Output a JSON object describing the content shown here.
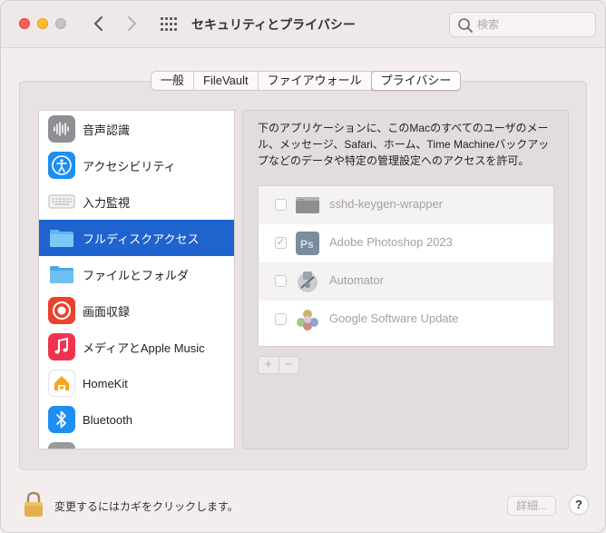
{
  "window": {
    "title": "セキュリティとプライバシー"
  },
  "search": {
    "placeholder": "検索"
  },
  "tabs": [
    {
      "label": "一般",
      "active": false
    },
    {
      "label": "FileVault",
      "active": false
    },
    {
      "label": "ファイアウォール",
      "active": false
    },
    {
      "label": "プライバシー",
      "active": true
    }
  ],
  "sidebar": {
    "selected_index": 3,
    "items": [
      {
        "label": "音声認識",
        "icon": "waveform-icon"
      },
      {
        "label": "アクセシビリティ",
        "icon": "accessibility-icon"
      },
      {
        "label": "入力監視",
        "icon": "keyboard-icon"
      },
      {
        "label": "フルディスクアクセス",
        "icon": "folder-icon"
      },
      {
        "label": "ファイルとフォルダ",
        "icon": "folder-icon"
      },
      {
        "label": "画面収録",
        "icon": "screen-record-icon"
      },
      {
        "label": "メディアとApple Music",
        "icon": "music-icon"
      },
      {
        "label": "HomeKit",
        "icon": "home-icon"
      },
      {
        "label": "Bluetooth",
        "icon": "bluetooth-icon"
      }
    ]
  },
  "main": {
    "description": "下のアプリケーションに、このMacのすべてのユーザのメール、メッセージ、Safari、ホーム、Time Machineバックアップなどのデータや特定の管理設定へのアクセスを許可。",
    "apps": [
      {
        "name": "sshd-keygen-wrapper",
        "checked": false,
        "icon": "terminal-icon"
      },
      {
        "name": "Adobe Photoshop 2023",
        "checked": true,
        "icon": "photoshop-icon"
      },
      {
        "name": "Automator",
        "checked": false,
        "icon": "automator-icon"
      },
      {
        "name": "Google Software Update",
        "checked": false,
        "icon": "google-update-icon"
      }
    ],
    "add_label": "+",
    "remove_label": "−"
  },
  "footer": {
    "lock_text": "変更するにはカギをクリックします。",
    "details_label": "詳細...",
    "help_label": "?"
  },
  "colors": {
    "selection": "#1f63cf",
    "close": "#ff5f57",
    "minimize": "#febc2e"
  }
}
